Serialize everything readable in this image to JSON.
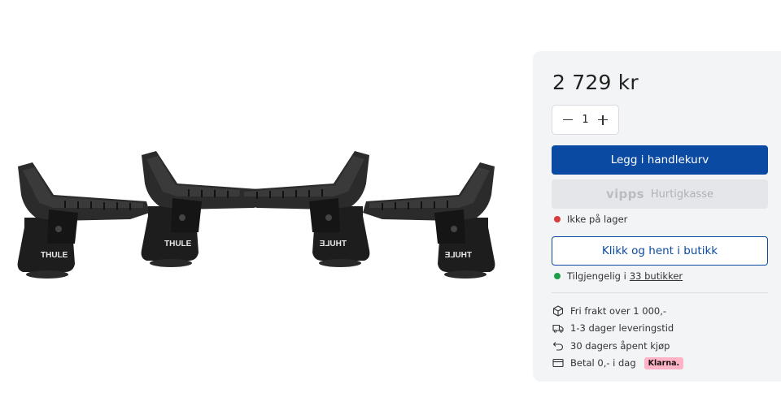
{
  "product": {
    "image_alt": "Thule kayak carrier cradles (4 pcs)",
    "brand_mark": "THULE",
    "price": "2 729 kr",
    "quantity": "1",
    "add_to_cart_label": "Legg i handlekurv",
    "vipps_logo": "vipps",
    "vipps_label": "Hurtigkasse",
    "stock_status": "Ikke på lager",
    "click_collect_label": "Klikk og hent i butikk",
    "availability_prefix": "Tilgjengelig i",
    "availability_link": "33 butikker"
  },
  "features": [
    {
      "icon": "package-icon",
      "text": "Fri frakt over 1 000,-"
    },
    {
      "icon": "truck-icon",
      "text": "1-3 dager leveringstid"
    },
    {
      "icon": "return-icon",
      "text": "30 dagers åpent kjøp"
    },
    {
      "icon": "card-icon",
      "text": "Betal 0,- i dag",
      "badge": "Klarna."
    }
  ],
  "colors": {
    "primary": "#0b4aa2",
    "out_of_stock": "#d93a3a",
    "available": "#1f9e4a",
    "klarna": "#ffb3c7"
  }
}
